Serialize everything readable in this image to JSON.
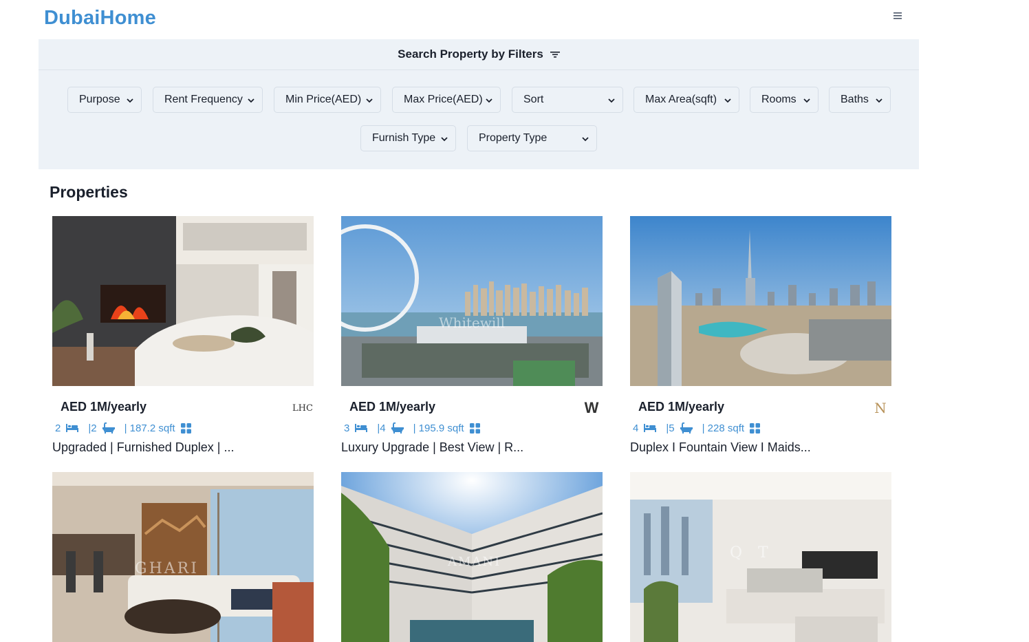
{
  "app": {
    "logo": "DubaiHome"
  },
  "filters": {
    "heading": "Search Property by Filters",
    "row1": [
      "Purpose",
      "Rent Frequency",
      "Min Price(AED)",
      "Max Price(AED)",
      "Sort",
      "Max Area(sqft)",
      "Rooms",
      "Baths"
    ],
    "row2": [
      "Furnish Type",
      "Property Type"
    ]
  },
  "properties": {
    "heading": "Properties",
    "cards": [
      {
        "price": "AED 1M/yearly",
        "rooms": "2",
        "baths": "|2",
        "area": "| 187.2 sqft",
        "title": "Upgraded | Furnished Duplex | ...",
        "agency_logo": "LHC"
      },
      {
        "price": "AED 1M/yearly",
        "rooms": "3",
        "baths": "|4",
        "area": "| 195.9 sqft",
        "title": "Luxury Upgrade | Best View | R...",
        "agency_logo": "W"
      },
      {
        "price": "AED 1M/yearly",
        "rooms": "4",
        "baths": "|5",
        "area": "| 228 sqft",
        "title": "Duplex I Fountain View I Maids...",
        "agency_logo": "N"
      },
      {
        "price": "",
        "rooms": "",
        "baths": "",
        "area": "",
        "title": ""
      },
      {
        "price": "",
        "rooms": "",
        "baths": "",
        "area": "",
        "title": ""
      },
      {
        "price": "",
        "rooms": "",
        "baths": "",
        "area": "",
        "title": ""
      }
    ],
    "watermarks": [
      "Whitewill",
      "GHARI",
      "AMANI",
      "Q  T"
    ]
  },
  "icons": {
    "menu": "hamburger-icon",
    "filter": "filter-lines-icon",
    "bed": "bed-icon",
    "bath": "bathtub-icon",
    "area": "grid-icon",
    "chevron": "chevron-down-icon"
  },
  "colors": {
    "brand": "#3f8fd2",
    "filter_bg": "#edf2f7"
  }
}
